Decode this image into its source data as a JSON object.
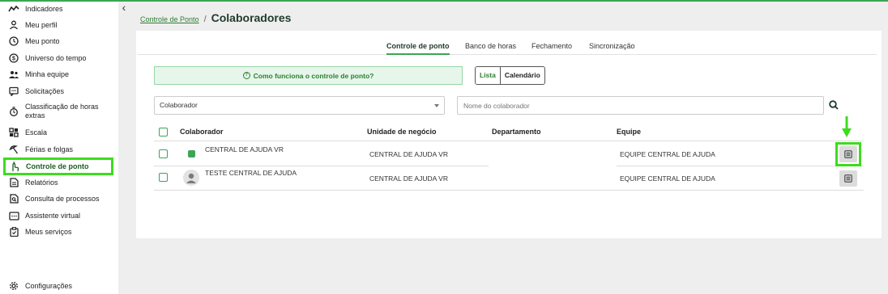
{
  "sidebar": {
    "items": [
      {
        "label": "Indicadores",
        "icon": "trend-icon"
      },
      {
        "label": "Meu perfil",
        "icon": "person-icon"
      },
      {
        "label": "Meu ponto",
        "icon": "clock-icon"
      },
      {
        "label": "Universo do tempo",
        "icon": "dollar-circle-icon"
      },
      {
        "label": "Minha equipe",
        "icon": "team-icon"
      },
      {
        "label": "Solicitações",
        "icon": "chat-icon"
      },
      {
        "label": "Classificação de horas extras",
        "icon": "timer-icon"
      },
      {
        "label": "Escala",
        "icon": "grid-icon"
      },
      {
        "label": "Férias e folgas",
        "icon": "beach-icon"
      },
      {
        "label": "Controle de ponto",
        "icon": "hand-icon",
        "active": true
      },
      {
        "label": "Relatórios",
        "icon": "document-icon"
      },
      {
        "label": "Consulta de processos",
        "icon": "search-document-icon"
      },
      {
        "label": "Assistente virtual",
        "icon": "assistant-icon"
      },
      {
        "label": "Meus serviços",
        "icon": "clipboard-icon"
      }
    ],
    "settings_label": "Configurações",
    "collapse_glyph": "‹"
  },
  "breadcrumb": {
    "link": "Controle de Ponto",
    "separator": "/",
    "title": "Colaboradores"
  },
  "tabs": [
    {
      "label": "Controle de ponto",
      "active": true
    },
    {
      "label": "Banco de horas",
      "active": false
    },
    {
      "label": "Fechamento",
      "active": false
    },
    {
      "label": "Sincronização",
      "active": false
    }
  ],
  "help": {
    "label": "Como funciona o controle de ponto?",
    "icon": "question-circle-icon"
  },
  "view_toggle": {
    "options": [
      "Lista",
      "Calendário"
    ],
    "selected": "Lista"
  },
  "filters": {
    "select_value": "Colaborador",
    "name_placeholder": "Nome do colaborador"
  },
  "table": {
    "headers": [
      "Colaborador",
      "Unidade de negócio",
      "Departamento",
      "Equipe"
    ],
    "rows": [
      {
        "colaborador": "CENTRAL DE AJUDA VR",
        "unidade": "CENTRAL DE AJUDA VR",
        "departamento": "",
        "equipe": "EQUIPE CENTRAL DE AJUDA",
        "avatar": "logo"
      },
      {
        "colaborador": "TESTE CENTRAL DE AJUDA",
        "unidade": "CENTRAL DE AJUDA VR",
        "departamento": "",
        "equipe": "EQUIPE CENTRAL DE AJUDA",
        "avatar": "person"
      }
    ]
  },
  "colors": {
    "accent": "#3aa655",
    "highlight": "#3ddc1d",
    "help_bg": "#e6f6ea"
  }
}
